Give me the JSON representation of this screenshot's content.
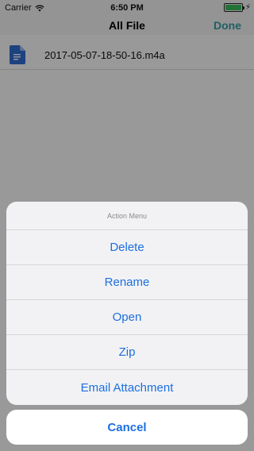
{
  "status_bar": {
    "carrier": "Carrier",
    "time": "6:50 PM"
  },
  "nav": {
    "title": "All File",
    "done_label": "Done"
  },
  "files": [
    {
      "name": "2017-05-07-18-50-16.m4a",
      "icon": "document-icon"
    }
  ],
  "action_sheet": {
    "title": "Action Menu",
    "items": [
      "Delete",
      "Rename",
      "Open",
      "Zip",
      "Email Attachment"
    ],
    "cancel_label": "Cancel"
  },
  "colors": {
    "accent_teal": "#3a9fa5",
    "action_blue": "#1c6fe0",
    "doc_blue": "#2f6fd6"
  }
}
